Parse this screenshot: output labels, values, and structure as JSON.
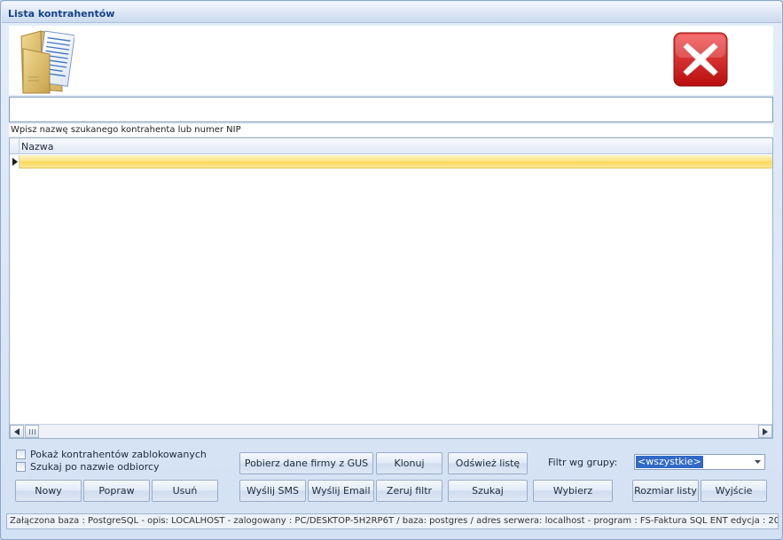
{
  "window": {
    "title": "Lista kontrahentów"
  },
  "search": {
    "value": "",
    "hint": "Wpisz nazwę szukanego kontrahenta lub numer NIP"
  },
  "grid": {
    "columns": [
      "Nazwa"
    ],
    "rows": [
      ""
    ]
  },
  "options": {
    "show_blocked": "Pokaż kontrahentów zablokowanych",
    "search_by_receiver": "Szukaj po nazwie odbiorcy"
  },
  "buttons": {
    "new": "Nowy",
    "edit": "Popraw",
    "delete": "Usuń",
    "gus": "Pobierz dane firmy z GUS",
    "clone": "Klonuj",
    "refresh": "Odśwież listę",
    "sms": "Wyślij SMS",
    "email": "Wyślij Email",
    "reset_filter": "Zeruj filtr",
    "search": "Szukaj",
    "select": "Wybierz",
    "list_size": "Rozmiar listy",
    "exit": "Wyjście"
  },
  "filter": {
    "label": "Filtr wg grupy:",
    "selected": "<wszystkie>"
  },
  "status": {
    "text": "Załączona baza : PostgreSQL - opis: LOCALHOST  -  zalogowany : PC/DESKTOP-5H2RP6T  / baza: postgres / adres serwera: localhost  -  program :  FS-Faktura SQL ENT edycja : 20"
  },
  "icons": {
    "header": "folder-documents-icon",
    "close": "close-icon",
    "row_pointer": "row-pointer-icon",
    "scroll_left": "scroll-left-arrow-icon",
    "scroll_right": "scroll-right-arrow-icon",
    "combo": "chevron-down-icon"
  },
  "colors": {
    "title": "#15428b",
    "selected_row": "#fde58b",
    "close_red": "#d91a1a",
    "selection": "#3169c6"
  }
}
